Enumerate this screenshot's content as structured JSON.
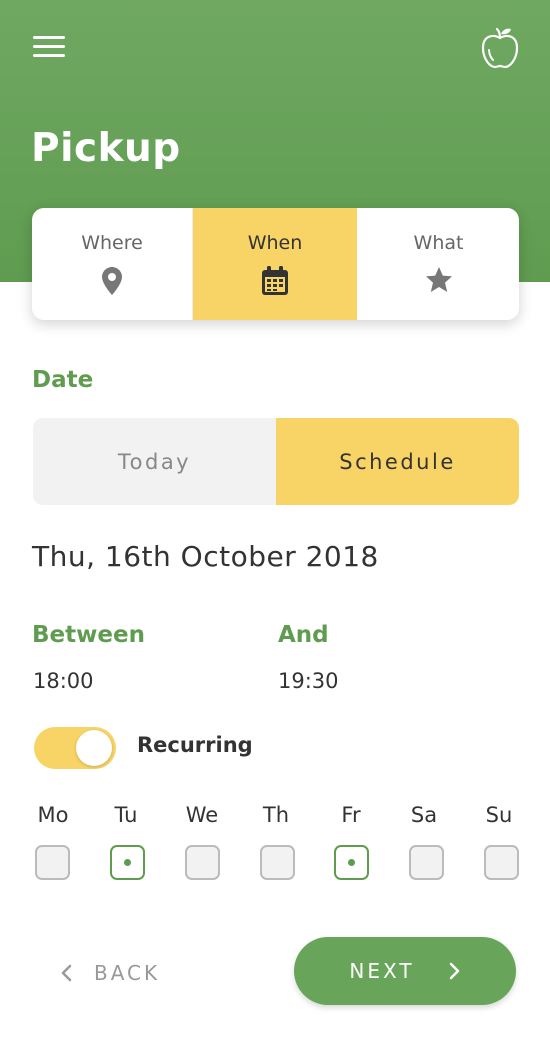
{
  "header": {
    "title": "Pickup",
    "menu_icon": "hamburger-menu-icon",
    "logo_icon": "apple-icon",
    "color": "#64a055"
  },
  "tabs": [
    {
      "label": "Where",
      "icon": "map-pin-icon",
      "active": false
    },
    {
      "label": "When",
      "icon": "calendar-icon",
      "active": true
    },
    {
      "label": "What",
      "icon": "star-icon",
      "active": false
    }
  ],
  "date": {
    "label": "Date",
    "options": [
      "Today",
      "Schedule"
    ],
    "selected": "Schedule",
    "value": "Thu, 16th October 2018"
  },
  "time": {
    "start_label": "Between",
    "start_value": "18:00",
    "end_label": "And",
    "end_value": "19:30"
  },
  "recurring": {
    "label": "Recurring",
    "enabled": true
  },
  "days": [
    {
      "label": "Mo",
      "checked": false
    },
    {
      "label": "Tu",
      "checked": true
    },
    {
      "label": "We",
      "checked": false
    },
    {
      "label": "Th",
      "checked": false
    },
    {
      "label": "Fr",
      "checked": true
    },
    {
      "label": "Sa",
      "checked": false
    },
    {
      "label": "Su",
      "checked": false
    }
  ],
  "footer": {
    "back_label": "BACK",
    "next_label": "NEXT"
  },
  "colors": {
    "accent_green": "#5f9c50",
    "accent_yellow": "#f8d466"
  }
}
